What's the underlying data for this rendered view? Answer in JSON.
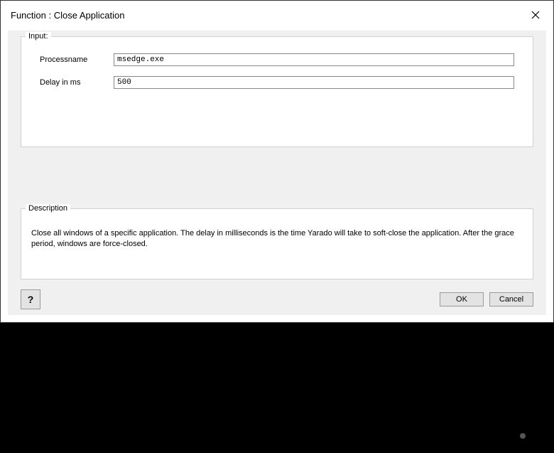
{
  "title": "Function : Close Application",
  "input_group": {
    "legend": "Input:",
    "fields": [
      {
        "label": "Processname",
        "value": "msedge.exe"
      },
      {
        "label": "Delay in ms",
        "value": "500"
      }
    ]
  },
  "description_group": {
    "legend": "Description",
    "text": "Close all windows of a specific application. The delay in milliseconds is the time Yarado will take to soft-close the application. After the grace period, windows are force-closed."
  },
  "buttons": {
    "help": "?",
    "ok": "OK",
    "cancel": "Cancel"
  }
}
